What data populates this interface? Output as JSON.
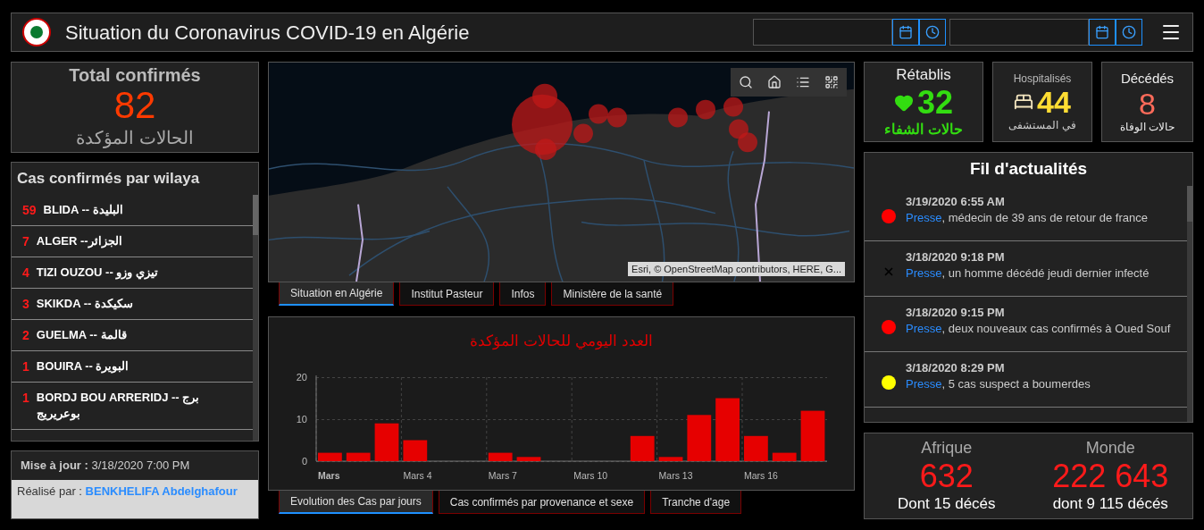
{
  "header": {
    "title": "Situation du Coronavirus COVID-19 en Algérie"
  },
  "total": {
    "title": "Total confirmés",
    "value": "82",
    "subtitle": "الحالات المؤكدة"
  },
  "wilaya": {
    "title": "Cas confirmés par wilaya",
    "items": [
      {
        "count": "59",
        "name": "BLIDA -- البليدة"
      },
      {
        "count": "7",
        "name": "ALGER --الجزائر"
      },
      {
        "count": "4",
        "name": "TIZI OUZOU -- تيزي وزو"
      },
      {
        "count": "3",
        "name": "SKIKDA -- سكيكدة"
      },
      {
        "count": "2",
        "name": "GUELMA -- قالمة"
      },
      {
        "count": "1",
        "name": "BOUIRA -- البويرة"
      },
      {
        "count": "1",
        "name": "BORDJ BOU ARRERIDJ -- برج بوعريريج"
      }
    ]
  },
  "update": {
    "label": "Mise à jour :",
    "value": "3/18/2020 7:00 PM",
    "author_label": "Réalisé par :",
    "author": "BENKHELIFA Abdelghafour"
  },
  "map": {
    "attribution": "Esri, © OpenStreetMap contributors, HERE, G..."
  },
  "map_tabs": [
    {
      "label": "Situation en Algérie",
      "selected": true
    },
    {
      "label": "Institut Pasteur",
      "selected": false
    },
    {
      "label": "Infos",
      "selected": false
    },
    {
      "label": "Ministère de la santé",
      "selected": false
    }
  ],
  "chart": {
    "chart_data": {
      "type": "bar",
      "title": "العدد اليومي للحالات المؤكدة",
      "categories": [
        "Mars",
        null,
        null,
        "Mars 4",
        null,
        null,
        "Mars 7",
        null,
        null,
        "Mars 10",
        null,
        null,
        "Mars 13",
        null,
        null,
        "Mars 16",
        null,
        null
      ],
      "series": [
        {
          "color": "#e60000",
          "values": [
            2,
            2,
            9,
            5,
            0,
            0,
            2,
            1,
            0,
            0,
            0,
            6,
            1,
            11,
            15,
            6,
            2,
            12
          ]
        }
      ],
      "ylim": [
        0,
        20
      ],
      "yticks": [
        0,
        10,
        20
      ]
    }
  },
  "chart_tabs": [
    {
      "label": "Evolution des Cas par jours",
      "selected": true
    },
    {
      "label": "Cas confirmés par provenance et sexe",
      "selected": false
    },
    {
      "label": "Tranche d'age",
      "selected": false
    }
  ],
  "recovered": {
    "title": "Rétablis",
    "value": "32",
    "subtitle": "حالات الشفاء"
  },
  "hospitalized": {
    "title": "Hospitalisés",
    "value": "44",
    "subtitle": "في المستشفى"
  },
  "deaths": {
    "title": "Décédés",
    "value": "8",
    "subtitle": "حالات الوفاة"
  },
  "news": {
    "title": "Fil d'actualités",
    "items": [
      {
        "kind": "dot",
        "color": "#ff0000",
        "date": "3/19/2020 6:55 AM",
        "source": "Presse",
        "text": ", médecin de 39 ans de retour de france"
      },
      {
        "kind": "cross",
        "date": "3/18/2020 9:18 PM",
        "source": "Presse",
        "text": ", un homme décédé jeudi dernier infecté"
      },
      {
        "kind": "dot",
        "color": "#ff0000",
        "date": "3/18/2020 9:15 PM",
        "source": "Presse",
        "text": ", deux nouveaux cas confirmés à Oued Souf"
      },
      {
        "kind": "dot",
        "color": "#ffff00",
        "date": "3/18/2020 8:29 PM",
        "source": "Presse",
        "text": ", 5 cas suspect a boumerdes"
      }
    ]
  },
  "world": [
    {
      "label": "Afrique",
      "value": "632",
      "note": "Dont 15 décés"
    },
    {
      "label": "Monde",
      "value": "222 643",
      "note": "dont 9 115 décés"
    }
  ]
}
